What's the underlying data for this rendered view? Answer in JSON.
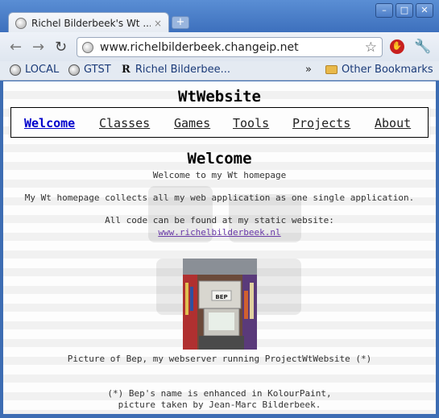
{
  "browser": {
    "tab_title": "Richel Bilderbeek's Wt ...",
    "tab_close": "×",
    "new_tab": "+",
    "window_buttons": [
      "–",
      "□",
      "✕"
    ],
    "url": "www.richelbilderbeek.changeip.net",
    "nav": {
      "back": "←",
      "forward": "→",
      "reload": "↻"
    },
    "icons": [
      "globe-icon",
      "star-icon",
      "stop-icon",
      "wrench-icon",
      "folder-icon"
    ]
  },
  "bookmarks": {
    "items": [
      {
        "label": "LOCAL",
        "icon": "globe-icon"
      },
      {
        "label": "GTST",
        "icon": "globe-icon"
      },
      {
        "label": "Richel Bilderbee...",
        "icon": "r-logo-icon",
        "logo_text": "R"
      }
    ],
    "overflow": "»",
    "other": "Other Bookmarks"
  },
  "page": {
    "site_title": "WtWebsite",
    "menu": [
      "Welcome",
      "Classes",
      "Games",
      "Tools",
      "Projects",
      "About"
    ],
    "active_menu": "Welcome",
    "heading": "Welcome",
    "lines": {
      "intro": "Welcome to my Wt homepage",
      "collects": "My Wt homepage collects all my web application as one single application.",
      "code": "All code can be found at my static website:",
      "link": "www.richelbilderbeek.nl",
      "caption": "Picture of Bep, my webserver running ProjectWtWebsite (*)",
      "note1": "(*) Bep's name is enhanced in KolourPaint,",
      "note2": "picture taken by Jean-Marc Bilderbeek."
    },
    "photo_label": "BEP"
  },
  "colors": {
    "chrome_blue": "#3d6db3",
    "link_visited": "#6a3aa8",
    "active_menu": "#0000cc"
  }
}
